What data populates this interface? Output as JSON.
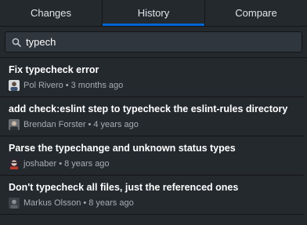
{
  "tabs": [
    {
      "label": "Changes"
    },
    {
      "label": "History"
    },
    {
      "label": "Compare"
    }
  ],
  "search": {
    "value": "typech"
  },
  "commits": [
    {
      "title": "Fix typecheck error",
      "author": "Pol Rivero",
      "time": "3 months ago"
    },
    {
      "title": "add check:eslint step to typecheck the eslint-rules directory",
      "author": "Brendan Forster",
      "time": "4 years ago"
    },
    {
      "title": "Parse the typechange and unknown status types",
      "author": "joshaber",
      "time": "8 years ago"
    },
    {
      "title": "Don't typecheck all files, just the referenced ones",
      "author": "Markus Olsson",
      "time": "8 years ago"
    }
  ],
  "colors": {
    "background": "#24292e",
    "active_tab_underline": "#0366d6",
    "search_bg": "#2f363d",
    "meta_text": "#a8adb3"
  }
}
